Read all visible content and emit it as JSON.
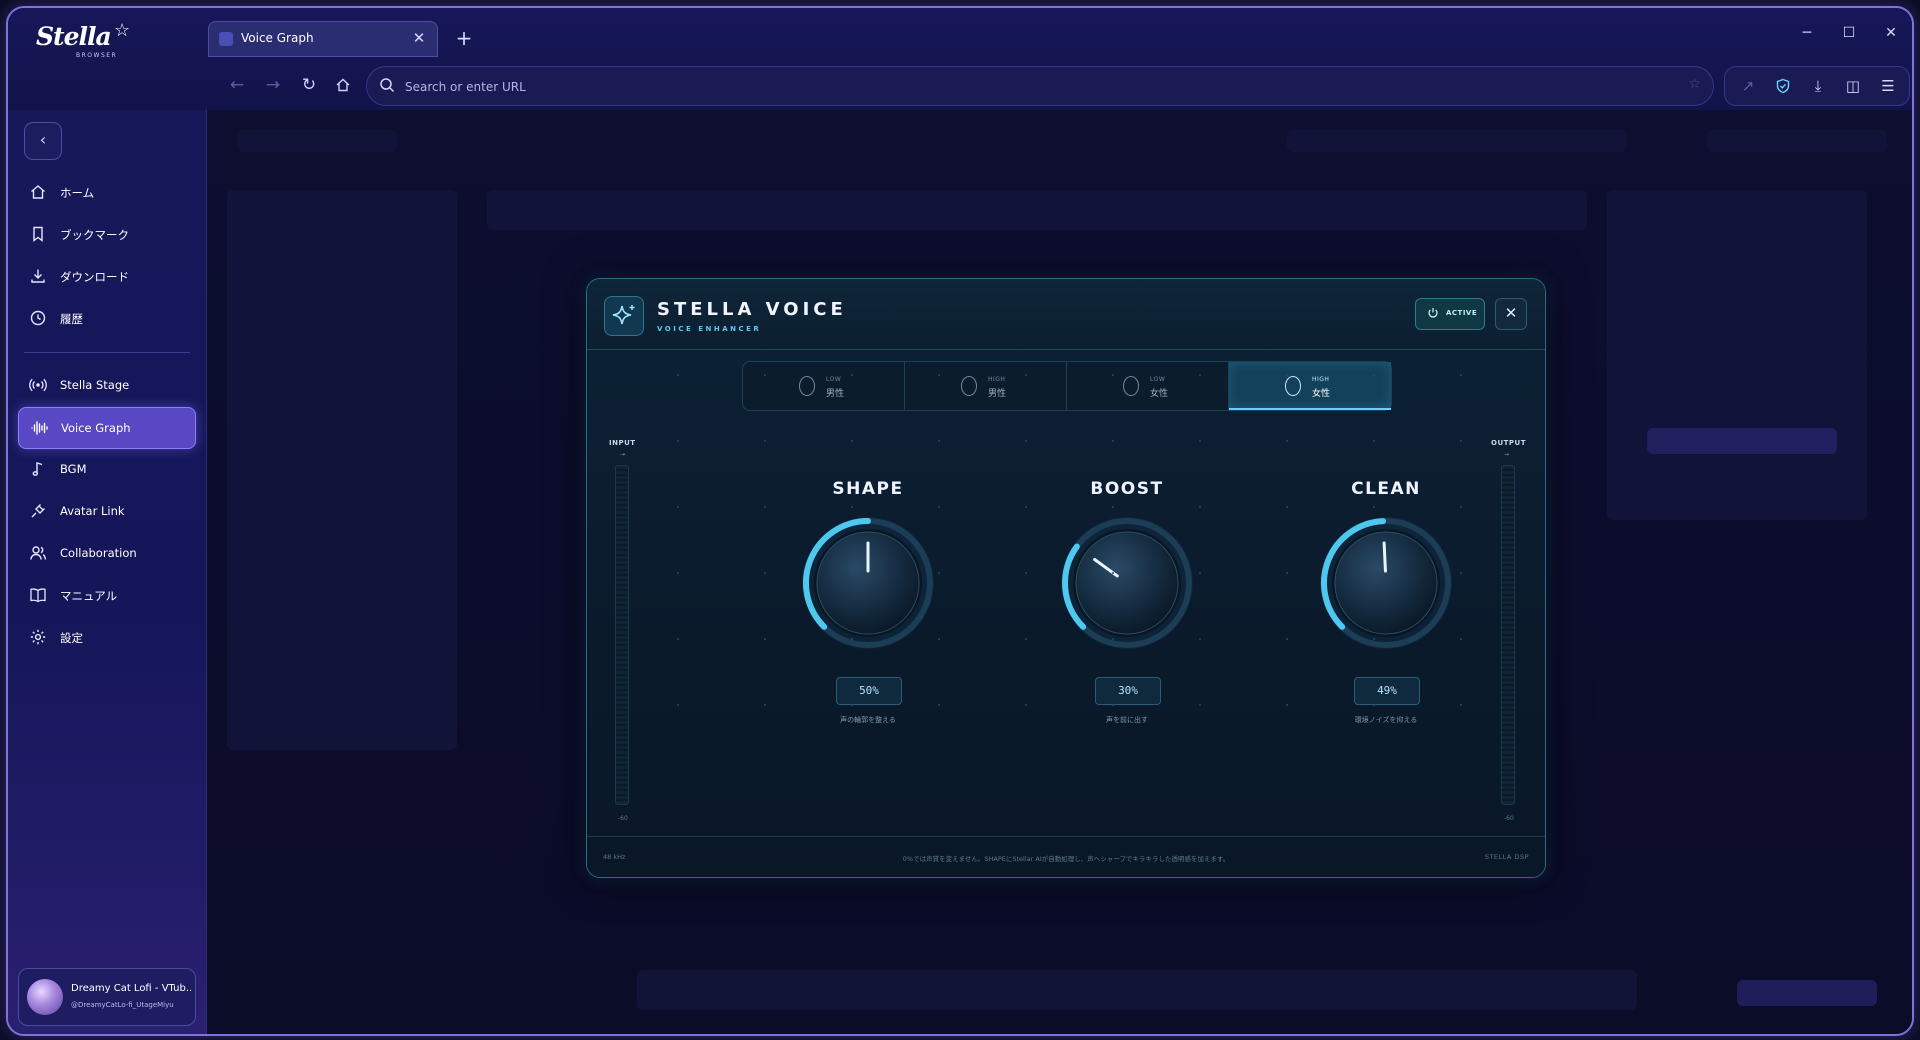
{
  "browser": {
    "logo_text": "Stella",
    "logo_sub": "BROWSER",
    "tab_title": "Voice Graph",
    "url_placeholder": "Search or enter URL"
  },
  "sidebar": {
    "items": [
      {
        "label": "ホーム",
        "icon": "home-icon"
      },
      {
        "label": "ブックマーク",
        "icon": "bookmark-icon"
      },
      {
        "label": "ダウンロード",
        "icon": "download-icon"
      },
      {
        "label": "履歴",
        "icon": "history-icon"
      },
      {
        "label": "Stella Stage",
        "icon": "broadcast-icon"
      },
      {
        "label": "Voice Graph",
        "icon": "waveform-icon",
        "active": true
      },
      {
        "label": "BGM",
        "icon": "music-note-icon"
      },
      {
        "label": "Avatar Link",
        "icon": "link-plug-icon"
      },
      {
        "label": "Collaboration",
        "icon": "users-icon"
      },
      {
        "label": "マニュアル",
        "icon": "book-icon"
      },
      {
        "label": "設定",
        "icon": "gear-icon"
      }
    ],
    "profile": {
      "name": "Dreamy Cat Lofi - VTub...",
      "handle": "@DreamyCatLo-fi_UtageMiyu"
    }
  },
  "panel": {
    "title": "STELLA VOICE",
    "subtitle": "VOICE ENHANCER",
    "status_label": "ACTIVE",
    "presets": [
      {
        "tag": "LOW",
        "name": "男性"
      },
      {
        "tag": "HIGH",
        "name": "男性"
      },
      {
        "tag": "LOW",
        "name": "女性"
      },
      {
        "tag": "HIGH",
        "name": "女性",
        "selected": true
      }
    ],
    "input_label": "INPUT",
    "output_label": "OUTPUT",
    "meter_min_in": "-60",
    "meter_min_out": "-60",
    "knobs": [
      {
        "label": "SHAPE",
        "value": 0.5,
        "display": "50%",
        "desc": "声の輪郭を整える"
      },
      {
        "label": "BOOST",
        "value": 0.3,
        "display": "30%",
        "desc": "声を前に出す"
      },
      {
        "label": "CLEAN",
        "value": 0.49,
        "display": "49%",
        "desc": "環境ノイズを抑える"
      }
    ],
    "footer_left": "48 kHz",
    "footer_center": "0%では声質を変えません。SHAPEにStellar AIが自動処理し、声へシャープでキラキラした透明感を加えます。",
    "footer_right": "STELLA DSP"
  },
  "colors": {
    "accent": "#5848c4",
    "panel_accent": "#4fc8f0",
    "frame_border": "#7f73d8"
  }
}
